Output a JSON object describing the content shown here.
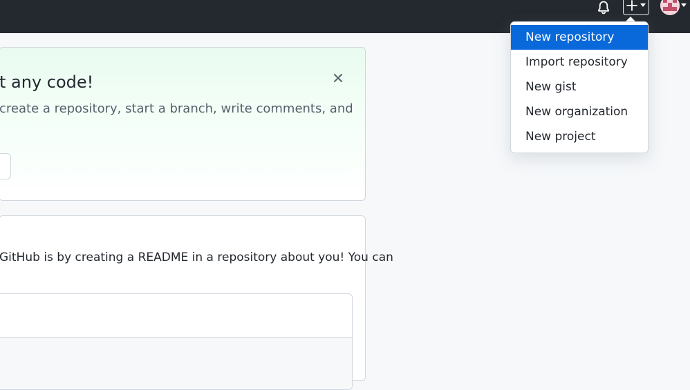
{
  "header": {
    "bell_icon": "bell-icon",
    "create_icon": "plus-icon",
    "create_caret_icon": "caret-down-icon",
    "avatar_caret_icon": "caret-down-icon",
    "bg_color": "#24292f"
  },
  "banner": {
    "title": "t any code!",
    "text": "create a repository, start a branch, write comments, and",
    "close_icon": "close-icon"
  },
  "readme_card": {
    "text": "GitHub is by creating a README in a repository about you! You can"
  },
  "create_menu": {
    "items": [
      {
        "label": "New repository",
        "active": true
      },
      {
        "label": "Import repository"
      },
      {
        "label": "New gist"
      },
      {
        "label": "New organization"
      },
      {
        "label": "New project"
      }
    ],
    "accent_color": "#0969da"
  }
}
